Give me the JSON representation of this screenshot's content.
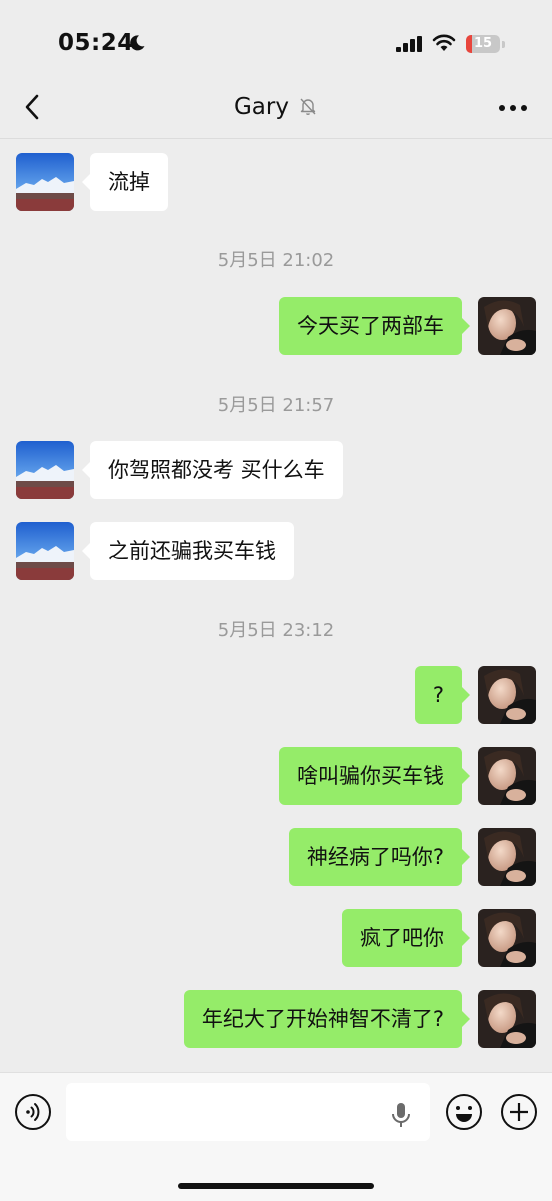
{
  "status_bar": {
    "time": "05:24",
    "battery": "15"
  },
  "nav": {
    "title": "Gary"
  },
  "messages": [
    {
      "text": "流掉"
    },
    {
      "timestamp": "5月5日 21:02"
    },
    {
      "text": "今天买了两部车"
    },
    {
      "timestamp": "5月5日 21:57"
    },
    {
      "text": "你驾照都没考 买什么车"
    },
    {
      "text": "之前还骗我买车钱"
    },
    {
      "timestamp": "5月5日 23:12"
    },
    {
      "text": "?"
    },
    {
      "text": "啥叫骗你买车钱"
    },
    {
      "text": "神经病了吗你?"
    },
    {
      "text": "疯了吧你"
    },
    {
      "text": "年纪大了开始神智不清了?"
    }
  ],
  "colors": {
    "outgoing_bubble": "#95ec69",
    "incoming_bubble": "#ffffff",
    "background": "#ededed"
  },
  "icons": [
    "moon-icon",
    "signal-icon",
    "wifi-icon",
    "battery-icon",
    "back-icon",
    "mute-bell-icon",
    "more-icon",
    "voice-icon",
    "mic-icon",
    "emoji-icon",
    "plus-icon"
  ]
}
